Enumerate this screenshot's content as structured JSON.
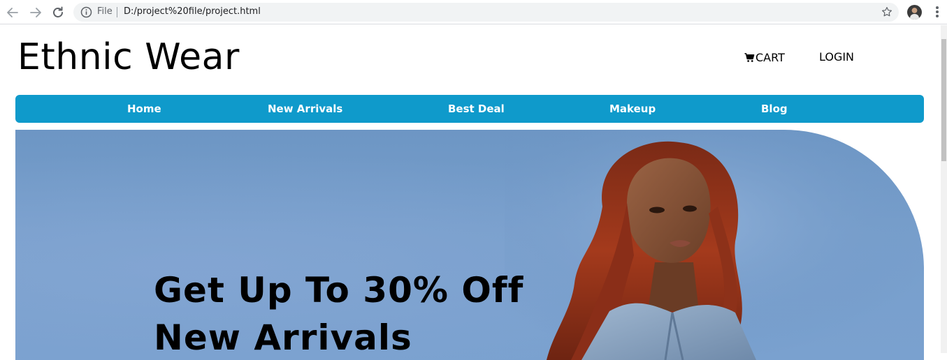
{
  "browser": {
    "scheme_label": "File",
    "url": "D:/project%20file/project.html",
    "icons": {
      "back": "back-arrow-icon",
      "forward": "forward-arrow-icon",
      "reload": "reload-icon",
      "info": "info-icon",
      "bookmark": "star-icon",
      "menu": "kebab-menu-icon"
    }
  },
  "header": {
    "brand": "Ethnic Wear",
    "cart_label": "CART",
    "login_label": "LOGIN"
  },
  "nav": {
    "items": [
      {
        "label": "Home"
      },
      {
        "label": "New Arrivals"
      },
      {
        "label": "Best Deal"
      },
      {
        "label": "Makeup"
      },
      {
        "label": "Blog"
      }
    ]
  },
  "hero": {
    "line1": "Get Up To 30% Off",
    "line2": "New Arrivals"
  },
  "colors": {
    "nav_bg": "#0f9acb",
    "hero_bg": "#789fcc",
    "nav_text": "#ffffff"
  }
}
